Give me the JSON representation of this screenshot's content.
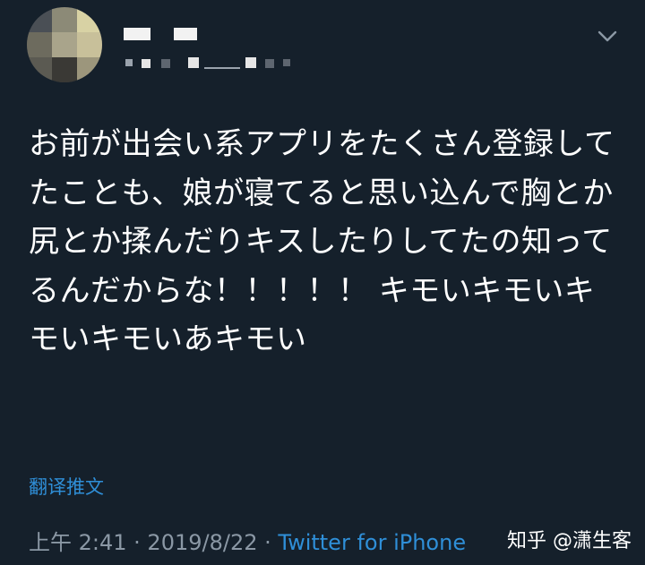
{
  "tweet": {
    "text": "お前が出会い系アプリをたくさん登録してたことも、娘が寝てると思い込んで胸とか尻とか揉んだりキスしたりしてたの知ってるんだからな！！！！！ キモいキモいキモいキモいあキモい",
    "translate_label": "翻译推文",
    "time": "上午 2:41",
    "separator1": " · ",
    "date": "2019/8/22",
    "separator2": " · ",
    "client": "Twitter for iPhone"
  },
  "watermark": "知乎 @潇生客",
  "colors": {
    "background": "#15202b",
    "text": "#ffffff",
    "link": "#2f8fd8",
    "muted": "#8b98a5"
  },
  "icons": {
    "menu": "chevron-down-icon"
  }
}
